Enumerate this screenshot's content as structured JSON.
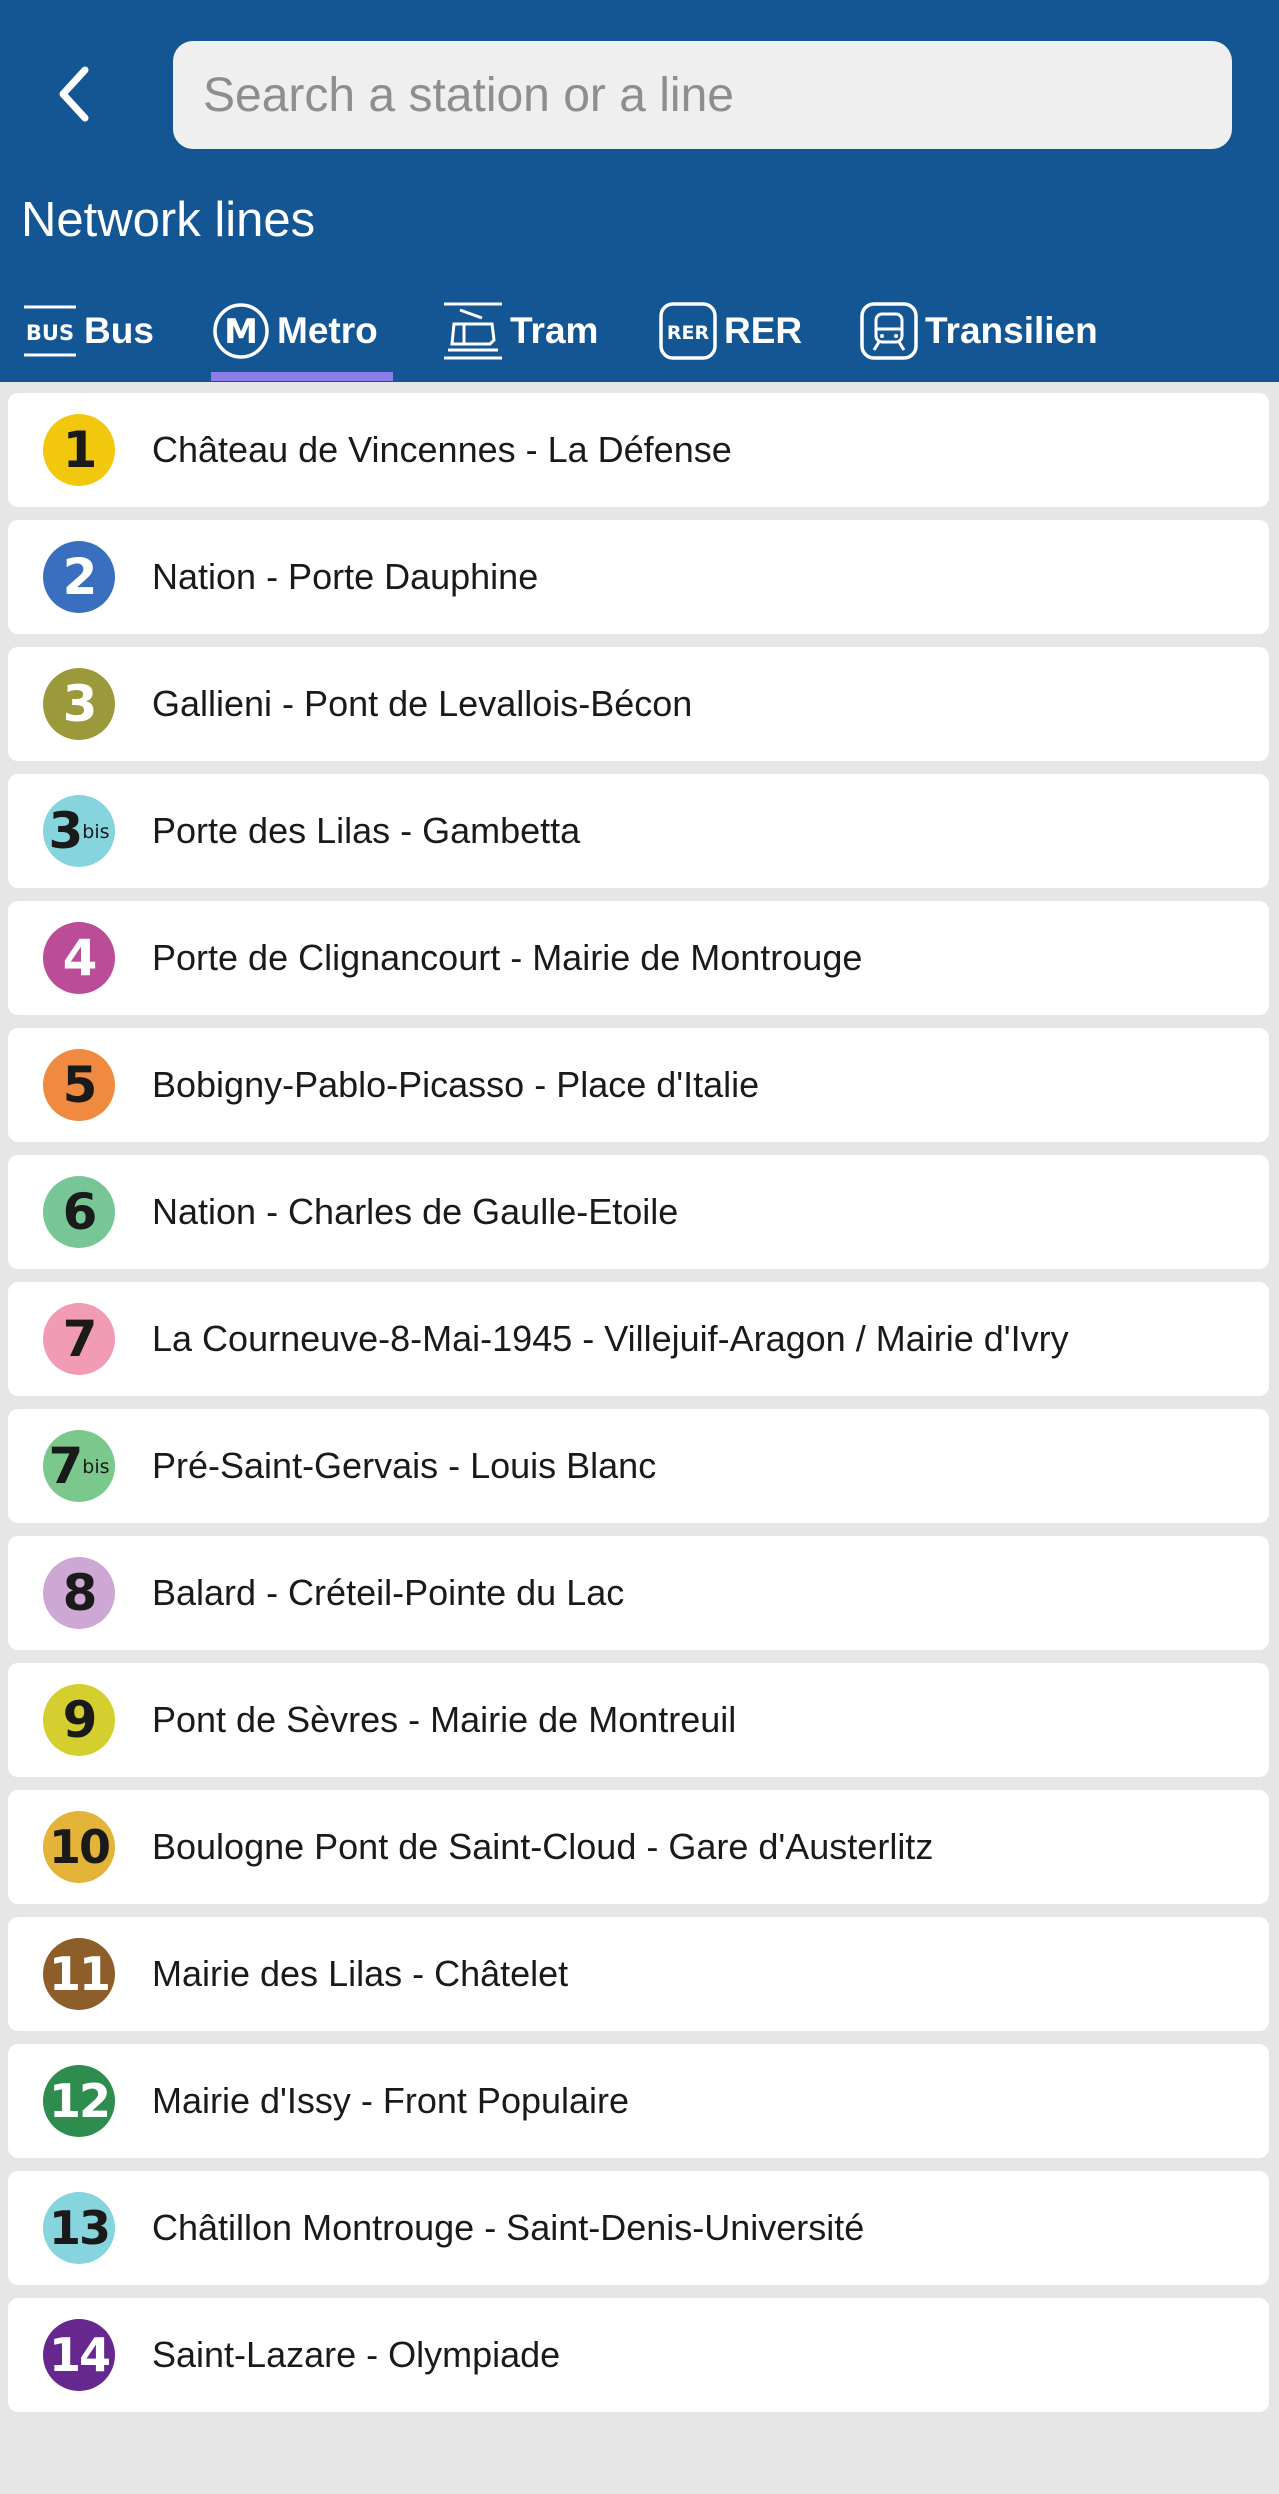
{
  "search": {
    "placeholder": "Search a station or a line"
  },
  "header": {
    "title": "Network lines"
  },
  "tabs": [
    {
      "label": "Bus",
      "icon": "bus-icon"
    },
    {
      "label": "Metro",
      "icon": "metro-icon",
      "selected": true
    },
    {
      "label": "Tram",
      "icon": "tram-icon"
    },
    {
      "label": "RER",
      "icon": "rer-icon"
    },
    {
      "label": "Transilien",
      "icon": "transilien-icon"
    }
  ],
  "bus_icon_text": "BUS",
  "rer_icon_text": "RER",
  "metro_icon_text": "M",
  "colors": {
    "header_bg": "#145594",
    "tab_underline": "#8b7ee8",
    "list_bg": "#e6e6e6"
  },
  "lines": [
    {
      "number": "1",
      "suffix": "",
      "name": "Château de Vincennes - La Défense",
      "color": "#f2c80f",
      "text_color": "#1a1a1a"
    },
    {
      "number": "2",
      "suffix": "",
      "name": "Nation - Porte Dauphine",
      "color": "#3a6fc0",
      "text_color": "#ffffff"
    },
    {
      "number": "3",
      "suffix": "",
      "name": "Gallieni - Pont de Levallois-Bécon",
      "color": "#9b993a",
      "text_color": "#ffffff"
    },
    {
      "number": "3",
      "suffix": "bis",
      "name": "Porte des Lilas - Gambetta",
      "color": "#86d4de",
      "text_color": "#1a1a1a"
    },
    {
      "number": "4",
      "suffix": "",
      "name": "Porte de Clignancourt - Mairie de Montrouge",
      "color": "#bb4d98",
      "text_color": "#ffffff"
    },
    {
      "number": "5",
      "suffix": "",
      "name": "Bobigny-Pablo-Picasso - Place d'Italie",
      "color": "#ef8a40",
      "text_color": "#1a1a1a"
    },
    {
      "number": "6",
      "suffix": "",
      "name": "Nation - Charles de Gaulle-Etoile",
      "color": "#78c695",
      "text_color": "#1a1a1a"
    },
    {
      "number": "7",
      "suffix": "",
      "name": "La Courneuve-8-Mai-1945 - Villejuif-Aragon / Mairie d'Ivry",
      "color": "#f19bb5",
      "text_color": "#1a1a1a"
    },
    {
      "number": "7",
      "suffix": "bis",
      "name": "Pré-Saint-Gervais - Louis Blanc",
      "color": "#7bc88c",
      "text_color": "#1a1a1a"
    },
    {
      "number": "8",
      "suffix": "",
      "name": "Balard - Créteil-Pointe du Lac",
      "color": "#cda8d4",
      "text_color": "#1a1a1a"
    },
    {
      "number": "9",
      "suffix": "",
      "name": "Pont de Sèvres - Mairie de Montreuil",
      "color": "#d4cf2f",
      "text_color": "#1a1a1a"
    },
    {
      "number": "10",
      "suffix": "",
      "name": "Boulogne Pont de Saint-Cloud - Gare d'Austerlitz",
      "color": "#e3b33a",
      "text_color": "#1a1a1a"
    },
    {
      "number": "11",
      "suffix": "",
      "name": "Mairie des Lilas - Châtelet",
      "color": "#8d5e2a",
      "text_color": "#ffffff"
    },
    {
      "number": "12",
      "suffix": "",
      "name": "Mairie d'Issy - Front Populaire",
      "color": "#2f8c4f",
      "text_color": "#ffffff"
    },
    {
      "number": "13",
      "suffix": "",
      "name": "Châtillon Montrouge - Saint-Denis-Université",
      "color": "#86d4de",
      "text_color": "#1a1a1a"
    },
    {
      "number": "14",
      "suffix": "",
      "name": "Saint-Lazare - Olympiade",
      "color": "#66288f",
      "text_color": "#ffffff"
    }
  ]
}
